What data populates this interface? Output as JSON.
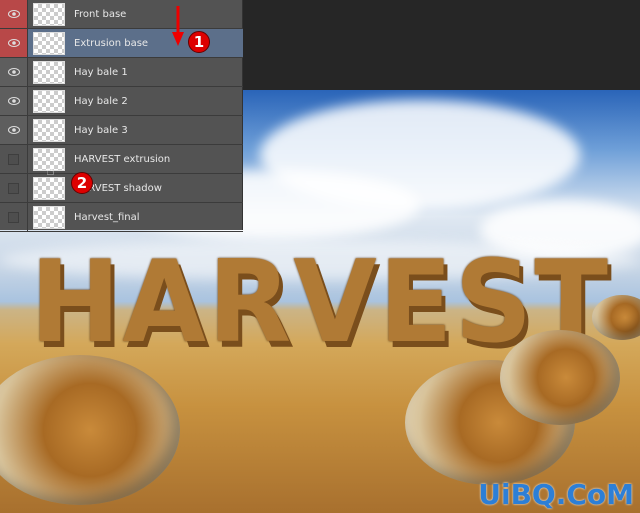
{
  "layers": [
    {
      "name": "Front base",
      "visible": true,
      "highlight": "red"
    },
    {
      "name": "Extrusion base",
      "visible": true,
      "highlight": "red",
      "selected": true
    },
    {
      "name": "Hay bale 1",
      "visible": true
    },
    {
      "name": "Hay bale 2",
      "visible": true
    },
    {
      "name": "Hay bale 3",
      "visible": true
    },
    {
      "name": "HARVEST extrusion",
      "visible": false
    },
    {
      "name": "HARVEST shadow",
      "visible": false
    },
    {
      "name": "Harvest_final",
      "visible": false
    }
  ],
  "annotations": {
    "step1": "1",
    "step2": "2"
  },
  "artwork": {
    "title": "HARVEST"
  },
  "watermark": "UiBQ.CoM",
  "colors": {
    "accent": "#d00000",
    "selected_row": "#5c6f8a",
    "eye_highlight": "#b84848"
  }
}
